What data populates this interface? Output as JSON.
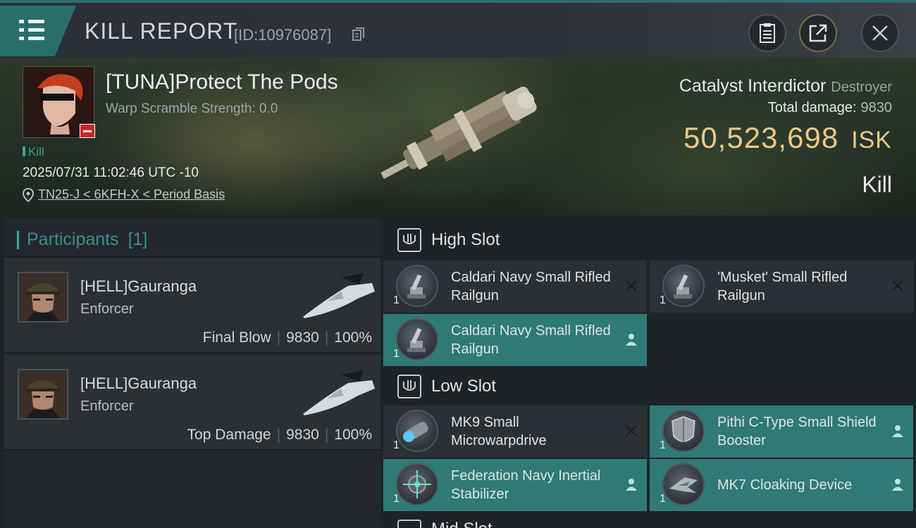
{
  "header": {
    "title": "KILL REPORT",
    "report_id": "[ID:10976087]"
  },
  "victim": {
    "name": "[TUNA]Protect The Pods",
    "warp_scramble": "Warp Scramble Strength: 0.0",
    "kill_tag": "Kill",
    "timestamp": "2025/07/31 11:02:46 UTC -10",
    "location": "TN25-J < 6KFH-X < Period Basis",
    "ship_name": "Catalyst Interdictor",
    "ship_class": "Destroyer",
    "total_damage_label": "Total damage:",
    "total_damage": "9830",
    "isk_value": "50,523,698",
    "isk_unit": "ISK",
    "result": "Kill"
  },
  "participants": {
    "title": "Participants",
    "count": "[1]",
    "items": [
      {
        "name": "[HELL]Gauranga",
        "ship": "Enforcer",
        "role": "Final Blow",
        "damage": "9830",
        "percent": "100%"
      },
      {
        "name": "[HELL]Gauranga",
        "ship": "Enforcer",
        "role": "Top Damage",
        "damage": "9830",
        "percent": "100%"
      }
    ]
  },
  "slots": {
    "high": {
      "label": "High Slot",
      "modules": [
        {
          "name": "Caldari Navy Small Rifled Railgun",
          "qty": "1",
          "status": "destroyed"
        },
        {
          "name": "'Musket' Small Rifled Railgun",
          "qty": "1",
          "status": "destroyed"
        },
        {
          "name": "Caldari Navy Small Rifled Railgun",
          "qty": "1",
          "status": "dropped"
        }
      ]
    },
    "low": {
      "label": "Low Slot",
      "modules": [
        {
          "name": "MK9 Small Microwarpdrive",
          "qty": "1",
          "status": "destroyed"
        },
        {
          "name": "Pithi C-Type Small Shield Booster",
          "qty": "1",
          "status": "dropped"
        },
        {
          "name": "Federation Navy Inertial Stabilizer",
          "qty": "1",
          "status": "dropped"
        },
        {
          "name": "MK7 Cloaking Device",
          "qty": "1",
          "status": "dropped"
        }
      ]
    },
    "next_label": "Mid Slot"
  },
  "colors": {
    "accent": "#2f7a74",
    "isk": "#e8c98a",
    "kill_tag": "#3aa38f"
  },
  "icons": {
    "menu": "hamburger-icon",
    "copy": "copy-icon",
    "doc": "clipboard-icon",
    "share": "share-icon",
    "close": "close-icon",
    "location": "map-pin-icon",
    "destroyed": "x-icon",
    "dropped": "person-icon"
  }
}
